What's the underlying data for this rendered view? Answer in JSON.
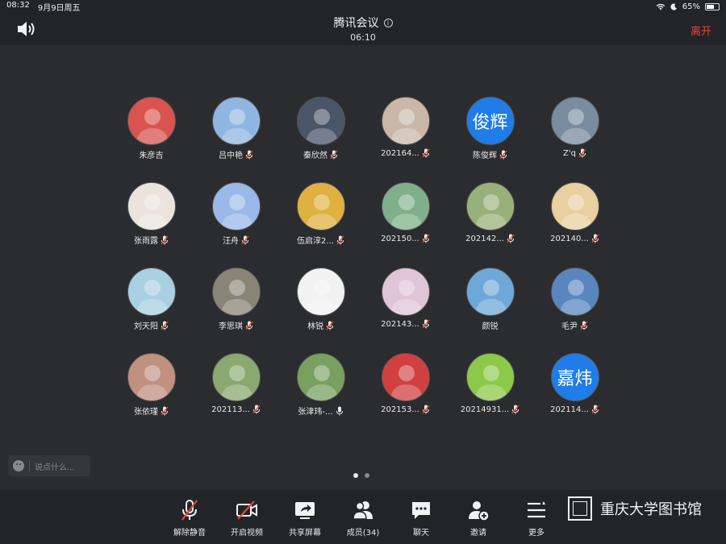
{
  "status": {
    "time": "08:32",
    "date": "9月9日周五",
    "battery": "65%",
    "battery_level": 0.65
  },
  "header": {
    "title": "腾讯会议",
    "timer": "06:10",
    "leave": "离开"
  },
  "participants": [
    {
      "name": "朱彦吉",
      "mic": "none",
      "color": "#d9534f",
      "avatar_text": ""
    },
    {
      "name": "吕中艳",
      "mic": "muted",
      "color": "#8fb6e0",
      "avatar_text": ""
    },
    {
      "name": "秦欣然",
      "mic": "muted",
      "color": "#4a5568",
      "avatar_text": ""
    },
    {
      "name": "202164...",
      "mic": "muted",
      "color": "#c9b8a8",
      "avatar_text": ""
    },
    {
      "name": "陈俊辉",
      "mic": "muted",
      "color": "#1f7ce8",
      "avatar_text": "俊辉"
    },
    {
      "name": "Z'q",
      "mic": "muted",
      "color": "#7a8c9e",
      "avatar_text": ""
    },
    {
      "name": "张雨露",
      "mic": "muted",
      "color": "#eae4dc",
      "avatar_text": ""
    },
    {
      "name": "汪舟",
      "mic": "muted",
      "color": "#9ab8e8",
      "avatar_text": ""
    },
    {
      "name": "伍启淳2...",
      "mic": "muted",
      "color": "#e0b040",
      "avatar_text": ""
    },
    {
      "name": "202150...",
      "mic": "muted",
      "color": "#7fb08a",
      "avatar_text": ""
    },
    {
      "name": "202142...",
      "mic": "muted",
      "color": "#98b07a",
      "avatar_text": ""
    },
    {
      "name": "202140...",
      "mic": "muted",
      "color": "#e8d0a0",
      "avatar_text": ""
    },
    {
      "name": "刘天阳",
      "mic": "muted",
      "color": "#a8d0e0",
      "avatar_text": ""
    },
    {
      "name": "李思琪",
      "mic": "muted",
      "color": "#8a8476",
      "avatar_text": ""
    },
    {
      "name": "林锐",
      "mic": "muted",
      "color": "#f2f2f2",
      "avatar_text": ""
    },
    {
      "name": "202143...",
      "mic": "muted",
      "color": "#e0c4d8",
      "avatar_text": ""
    },
    {
      "name": "颜锐",
      "mic": "none",
      "color": "#6ea8d8",
      "avatar_text": ""
    },
    {
      "name": "毛尹",
      "mic": "muted",
      "color": "#5a86c0",
      "avatar_text": ""
    },
    {
      "name": "张依瑾",
      "mic": "muted",
      "color": "#c09080",
      "avatar_text": ""
    },
    {
      "name": "202113...",
      "mic": "muted",
      "color": "#8aa870",
      "avatar_text": ""
    },
    {
      "name": "张津玮-...",
      "mic": "on",
      "color": "#7aa060",
      "avatar_text": ""
    },
    {
      "name": "202153...",
      "mic": "muted",
      "color": "#d04040",
      "avatar_text": ""
    },
    {
      "name": "20214931...",
      "mic": "muted",
      "color": "#8cc84a",
      "avatar_text": ""
    },
    {
      "name": "202114...",
      "mic": "muted",
      "color": "#1f7ce8",
      "avatar_text": "嘉炜"
    }
  ],
  "chat": {
    "placeholder": "说点什么..."
  },
  "toolbar": {
    "unmute": "解除静音",
    "video": "开启视频",
    "share": "共享屏幕",
    "members": "成员(34)",
    "chat": "聊天",
    "invite": "邀请",
    "more": "更多"
  },
  "watermark": "重庆大学图书馆",
  "colors": {
    "leave": "#e2473d",
    "background": "#2b2c2f",
    "bar": "#232427"
  }
}
